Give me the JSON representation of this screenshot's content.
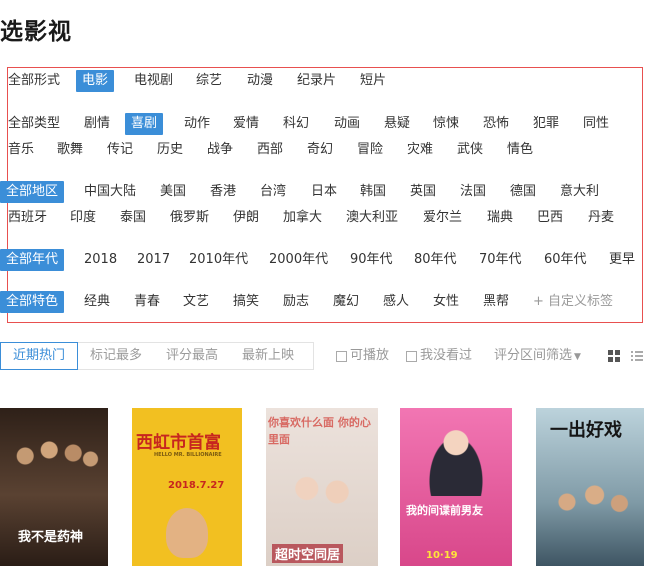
{
  "page": {
    "title": "选影视"
  },
  "filters": {
    "form": {
      "all": "全部形式",
      "items": [
        "电影",
        "电视剧",
        "综艺",
        "动漫",
        "纪录片",
        "短片"
      ]
    },
    "type": {
      "all": "全部类型",
      "items": [
        "剧情",
        "喜剧",
        "动作",
        "爱情",
        "科幻",
        "动画",
        "悬疑",
        "惊悚",
        "恐怖",
        "犯罪",
        "同性",
        "音乐",
        "歌舞",
        "传记",
        "历史",
        "战争",
        "西部",
        "奇幻",
        "冒险",
        "灾难",
        "武侠",
        "情色"
      ]
    },
    "region": {
      "all": "全部地区",
      "items": [
        "中国大陆",
        "美国",
        "香港",
        "台湾",
        "日本",
        "韩国",
        "英国",
        "法国",
        "德国",
        "意大利",
        "西班牙",
        "印度",
        "泰国",
        "俄罗斯",
        "伊朗",
        "加拿大",
        "澳大利亚",
        "爱尔兰",
        "瑞典",
        "巴西",
        "丹麦"
      ]
    },
    "year": {
      "all": "全部年代",
      "items": [
        "2018",
        "2017",
        "2010年代",
        "2000年代",
        "90年代",
        "80年代",
        "70年代",
        "60年代",
        "更早"
      ]
    },
    "feature": {
      "all": "全部特色",
      "items": [
        "经典",
        "青春",
        "文艺",
        "搞笑",
        "励志",
        "魔幻",
        "感人",
        "女性",
        "黑帮"
      ],
      "custom": "+ 自定义标签"
    }
  },
  "selected": {
    "form": "电影",
    "type": "喜剧",
    "region": "全部地区",
    "year": "全部年代",
    "feature": "全部特色"
  },
  "sort": {
    "tabs": [
      "近期热门",
      "标记最多",
      "评分最高",
      "最新上映"
    ],
    "active": "近期热门"
  },
  "options": {
    "playable": "可播放",
    "not_seen": "我没看过",
    "score_range": "评分区间筛选"
  },
  "posters": [
    {
      "title": "我不是药神",
      "bg": "#3b2c22"
    },
    {
      "title": "西虹市首富",
      "subtitle": "HELLO MR. BILLIONAIRE",
      "date": "2018.7.27",
      "bg": "#f2c021"
    },
    {
      "title": "你喜欢什么面 你的心里面",
      "bottom": "超时空同居",
      "bg": "#e9ddd6"
    },
    {
      "title": "我的间谍前男友",
      "date": "10·19",
      "bg": "#e7579b"
    },
    {
      "title": "一出好戏",
      "bg": "#a9c3cf"
    }
  ],
  "colors": {
    "accent": "#3b8ed8",
    "highlight_border": "#e8504f"
  }
}
